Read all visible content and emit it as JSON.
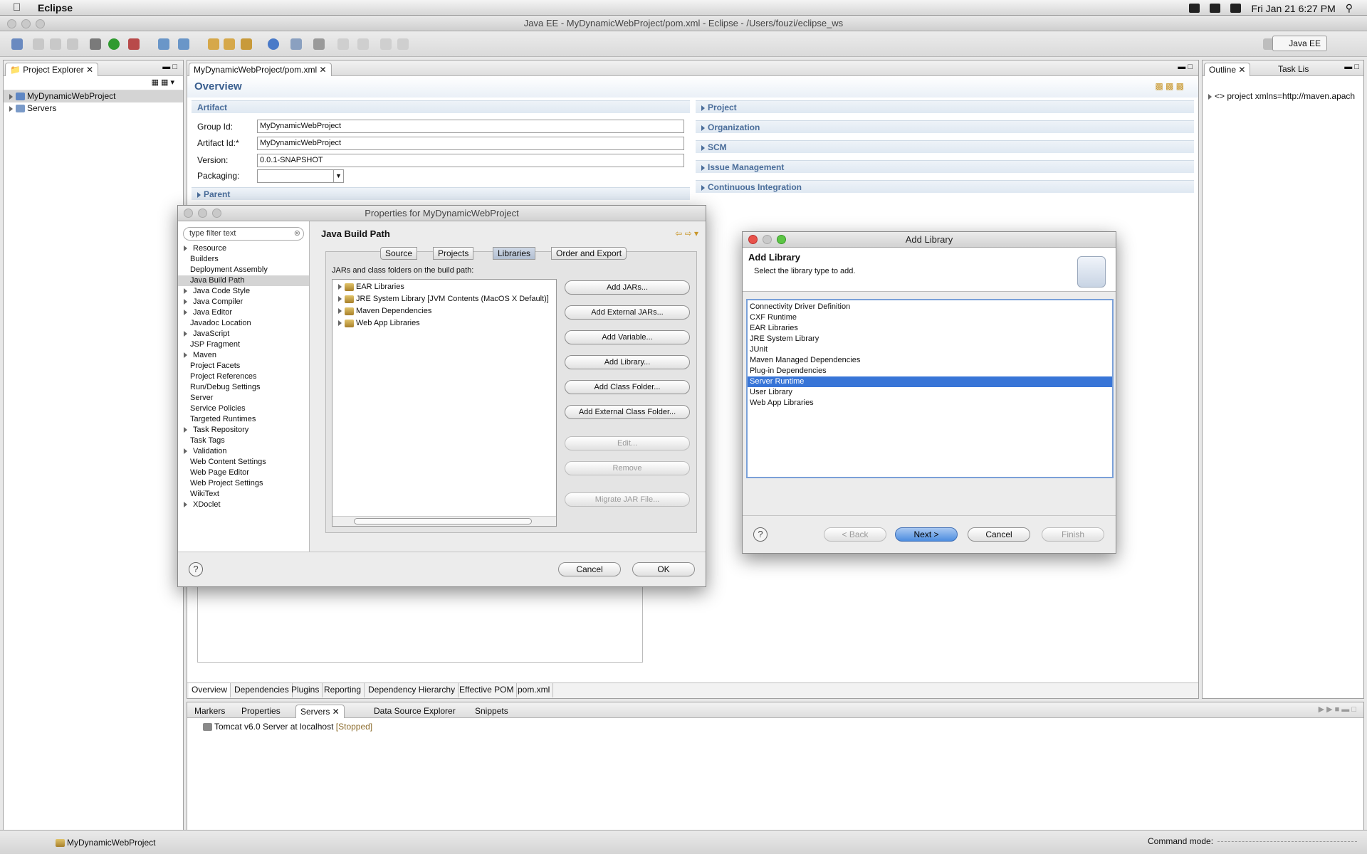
{
  "menubar": {
    "app_name": "Eclipse",
    "clock": "Fri Jan 21  6:27 PM"
  },
  "window": {
    "title": "Java EE - MyDynamicWebProject/pom.xml - Eclipse - /Users/fouzi/eclipse_ws",
    "perspective": "Java EE"
  },
  "project_explorer": {
    "tab": "Project Explorer",
    "items": [
      "MyDynamicWebProject",
      "Servers"
    ]
  },
  "editor": {
    "tab": "MyDynamicWebProject/pom.xml",
    "heading": "Overview",
    "artifact_section": "Artifact",
    "group_id_label": "Group Id:",
    "group_id": "MyDynamicWebProject",
    "artifact_id_label": "Artifact Id:*",
    "artifact_id": "MyDynamicWebProject",
    "version_label": "Version:",
    "version": "0.0.1-SNAPSHOT",
    "packaging_label": "Packaging:",
    "parent_section": "Parent",
    "right_sections": [
      "Project",
      "Organization",
      "SCM",
      "Issue Management",
      "Continuous Integration"
    ],
    "bottom_tabs": [
      "Overview",
      "Dependencies",
      "Plugins",
      "Reporting",
      "Dependency Hierarchy",
      "Effective POM",
      "pom.xml"
    ]
  },
  "outline": {
    "tabs": [
      "Outline",
      "Task Lis"
    ],
    "item": "<> project xmlns=http://maven.apach"
  },
  "servers": {
    "tabs": [
      "Markers",
      "Properties",
      "Servers",
      "Data Source Explorer",
      "Snippets"
    ],
    "server": "Tomcat v6.0 Server at localhost",
    "state": "[Stopped]"
  },
  "statusbar": {
    "project": "MyDynamicWebProject",
    "command_mode": "Command mode:"
  },
  "properties_dialog": {
    "title": "Properties for MyDynamicWebProject",
    "filter_placeholder": "type filter text",
    "nav": [
      {
        "label": "Resource",
        "expandable": true
      },
      {
        "label": "Builders",
        "expandable": false
      },
      {
        "label": "Deployment Assembly",
        "expandable": false
      },
      {
        "label": "Java Build Path",
        "expandable": false,
        "selected": true
      },
      {
        "label": "Java Code Style",
        "expandable": true
      },
      {
        "label": "Java Compiler",
        "expandable": true
      },
      {
        "label": "Java Editor",
        "expandable": true
      },
      {
        "label": "Javadoc Location",
        "expandable": false
      },
      {
        "label": "JavaScript",
        "expandable": true
      },
      {
        "label": "JSP Fragment",
        "expandable": false
      },
      {
        "label": "Maven",
        "expandable": true
      },
      {
        "label": "Project Facets",
        "expandable": false
      },
      {
        "label": "Project References",
        "expandable": false
      },
      {
        "label": "Run/Debug Settings",
        "expandable": false
      },
      {
        "label": "Server",
        "expandable": false
      },
      {
        "label": "Service Policies",
        "expandable": false
      },
      {
        "label": "Targeted Runtimes",
        "expandable": false
      },
      {
        "label": "Task Repository",
        "expandable": true
      },
      {
        "label": "Task Tags",
        "expandable": false
      },
      {
        "label": "Validation",
        "expandable": true
      },
      {
        "label": "Web Content Settings",
        "expandable": false
      },
      {
        "label": "Web Page Editor",
        "expandable": false
      },
      {
        "label": "Web Project Settings",
        "expandable": false
      },
      {
        "label": "WikiText",
        "expandable": false
      },
      {
        "label": "XDoclet",
        "expandable": true
      }
    ],
    "page_title": "Java Build Path",
    "tabs": [
      "Source",
      "Projects",
      "Libraries",
      "Order and Export"
    ],
    "active_tab": "Libraries",
    "libs_caption": "JARs and class folders on the build path:",
    "libraries": [
      "EAR Libraries",
      "JRE System Library [JVM Contents (MacOS X Default)]",
      "Maven Dependencies",
      "Web App Libraries"
    ],
    "buttons": [
      "Add JARs...",
      "Add External JARs...",
      "Add Variable...",
      "Add Library...",
      "Add Class Folder...",
      "Add External Class Folder..."
    ],
    "disabled_buttons": [
      "Edit...",
      "Remove",
      "Migrate JAR File..."
    ],
    "cancel": "Cancel",
    "ok": "OK"
  },
  "add_library_dialog": {
    "title": "Add Library",
    "heading": "Add Library",
    "subtitle": "Select the library type to add.",
    "items": [
      "Connectivity Driver Definition",
      "CXF Runtime",
      "EAR Libraries",
      "JRE System Library",
      "JUnit",
      "Maven Managed Dependencies",
      "Plug-in Dependencies",
      "Server Runtime",
      "User Library",
      "Web App Libraries"
    ],
    "selected": "Server Runtime",
    "back": "< Back",
    "next": "Next >",
    "cancel": "Cancel",
    "finish": "Finish"
  }
}
